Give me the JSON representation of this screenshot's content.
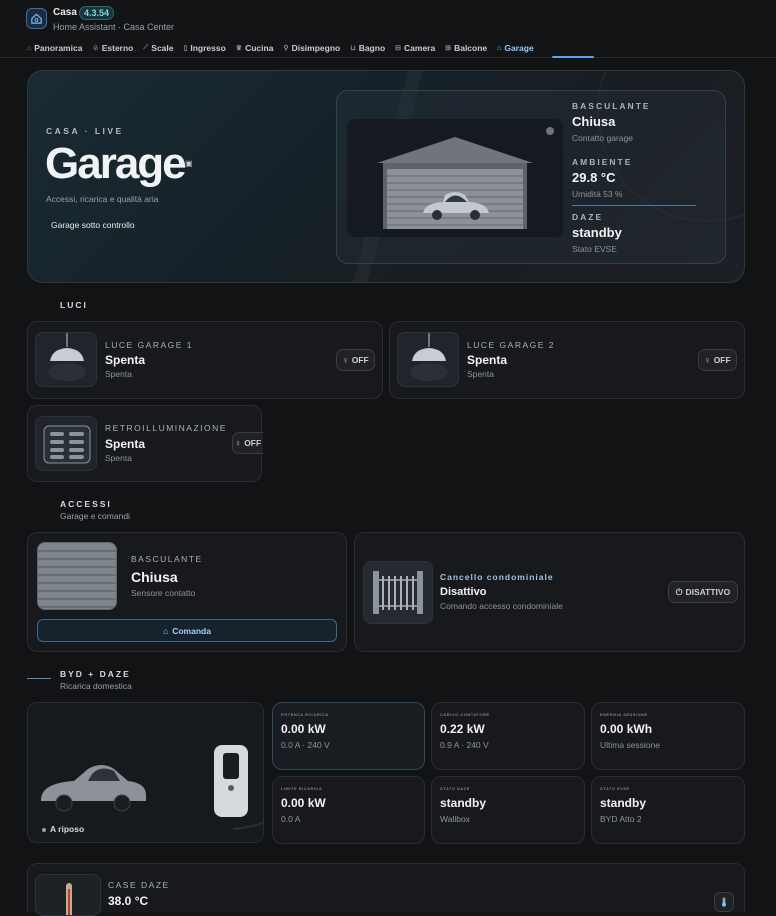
{
  "app": {
    "title": "Casa",
    "version": "4.3.54",
    "subtitle": "Home Assistant · Casa Center"
  },
  "tabs": [
    {
      "label": "Panoramica",
      "icon": "home-icon"
    },
    {
      "label": "Esterno",
      "icon": "tree-icon"
    },
    {
      "label": "Scale",
      "icon": "stairs-icon"
    },
    {
      "label": "Ingresso",
      "icon": "door-icon"
    },
    {
      "label": "Cucina",
      "icon": "chef-icon"
    },
    {
      "label": "Disimpegno",
      "icon": "walk-icon"
    },
    {
      "label": "Bagno",
      "icon": "bath-icon"
    },
    {
      "label": "Camera",
      "icon": "bed-icon"
    },
    {
      "label": "Balcone",
      "icon": "balcony-icon"
    },
    {
      "label": "Garage",
      "icon": "garage-icon"
    }
  ],
  "active_tab": "Garage",
  "hero": {
    "kicker": "CASA · LIVE",
    "title": "Garage",
    "description": "Accessi, ricarica e qualità aria",
    "status": "Garage sotto controllo",
    "basculante": {
      "kicker": "BASCULANTE",
      "value": "Chiusa",
      "sub": "Contatto garage"
    },
    "ambiente": {
      "kicker": "AMBIENTE",
      "value": "29.8 °C",
      "sub": "Umidità 53 %"
    },
    "daze": {
      "kicker": "DAZE",
      "value": "standby",
      "sub": "Stato EVSE"
    }
  },
  "luci": {
    "title": "LUCI",
    "items": [
      {
        "kicker": "LUCE GARAGE 1",
        "title": "Spenta",
        "sub": "Spenta",
        "state": "OFF"
      },
      {
        "kicker": "LUCE GARAGE 2",
        "title": "Spenta",
        "sub": "Spenta",
        "state": "OFF"
      },
      {
        "kicker": "RETROILLUMINAZIONE",
        "title": "Spenta",
        "sub": "Spenta",
        "state": "OFF"
      }
    ]
  },
  "accessi": {
    "title": "ACCESSI",
    "subtitle": "Garage e comandi",
    "basculante": {
      "kicker": "BASCULANTE",
      "title": "Chiusa",
      "sub": "Sensore contatto",
      "button": "Comanda"
    },
    "cancello": {
      "kicker": "Cancello condominiale",
      "title": "Disattivo",
      "sub": "Comando accesso condominiale",
      "button": "DISATTIVO"
    }
  },
  "ev": {
    "title": "BYD + DAZE",
    "subtitle": "Ricarica domestica",
    "car_status": "A riposo",
    "metrics": [
      {
        "kicker": "POTENZA RICARICA",
        "value": "0.00 kW",
        "sub": "0.0 A · 240 V",
        "highlight": true
      },
      {
        "kicker": "CARICO CONTATORE",
        "value": "0.22 kW",
        "sub": "0.9 A · 240 V"
      },
      {
        "kicker": "ENERGIA SESSIONE",
        "value": "0.00 kWh",
        "sub": "Ultima sessione"
      },
      {
        "kicker": "LIMITE RICARICA",
        "value": "0.00 kW",
        "sub": "0.0 A"
      },
      {
        "kicker": "STATO DAZE",
        "value": "standby",
        "sub": "Wallbox"
      },
      {
        "kicker": "STATO EVSE",
        "value": "standby",
        "sub": "BYD Atto 2"
      }
    ]
  },
  "case_daze": {
    "kicker": "CASE DAZE",
    "value": "38.0 °C"
  }
}
